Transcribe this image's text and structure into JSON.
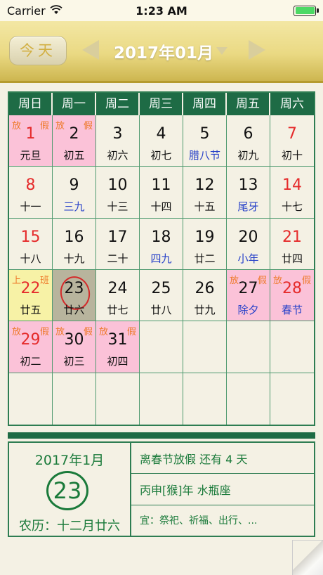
{
  "status": {
    "carrier": "Carrier",
    "time": "1:23 AM",
    "battery_color": "#4cd964"
  },
  "header": {
    "today_label": "今天",
    "month_title": "2017年01月"
  },
  "weekdays": [
    "周日",
    "周一",
    "周二",
    "周三",
    "周四",
    "周五",
    "周六"
  ],
  "days": [
    {
      "n": "1",
      "l": "元旦",
      "t1": "放",
      "t2": "假"
    },
    {
      "n": "2",
      "l": "初五",
      "t1": "放",
      "t2": "假"
    },
    {
      "n": "3",
      "l": "初六"
    },
    {
      "n": "4",
      "l": "初七"
    },
    {
      "n": "5",
      "l": "腊八节"
    },
    {
      "n": "6",
      "l": "初九"
    },
    {
      "n": "7",
      "l": "初十"
    },
    {
      "n": "8",
      "l": "十一"
    },
    {
      "n": "9",
      "l": "三九"
    },
    {
      "n": "10",
      "l": "十三"
    },
    {
      "n": "11",
      "l": "十四"
    },
    {
      "n": "12",
      "l": "十五"
    },
    {
      "n": "13",
      "l": "尾牙"
    },
    {
      "n": "14",
      "l": "十七"
    },
    {
      "n": "15",
      "l": "十八"
    },
    {
      "n": "16",
      "l": "十九"
    },
    {
      "n": "17",
      "l": "二十"
    },
    {
      "n": "18",
      "l": "四九"
    },
    {
      "n": "19",
      "l": "廿二"
    },
    {
      "n": "20",
      "l": "小年"
    },
    {
      "n": "21",
      "l": "廿四"
    },
    {
      "n": "22",
      "l": "廿五",
      "t1": "上",
      "t2": "班"
    },
    {
      "n": "23",
      "l": "廿六"
    },
    {
      "n": "24",
      "l": "廿七"
    },
    {
      "n": "25",
      "l": "廿八"
    },
    {
      "n": "26",
      "l": "廿九"
    },
    {
      "n": "27",
      "l": "除夕",
      "t1": "放",
      "t2": "假"
    },
    {
      "n": "28",
      "l": "春节",
      "t1": "放",
      "t2": "假"
    },
    {
      "n": "29",
      "l": "初二",
      "t1": "放",
      "t2": "假"
    },
    {
      "n": "30",
      "l": "初三",
      "t1": "放",
      "t2": "假"
    },
    {
      "n": "31",
      "l": "初四",
      "t1": "放",
      "t2": "假"
    }
  ],
  "info": {
    "year_month": "2017年1月",
    "day": "23",
    "lunar_date": "农历：十二月廿六",
    "countdown": "离春节放假 还有 4 天",
    "zodiac": "丙申[猴]年 水瓶座",
    "suitable": "宜：祭祀、祈福、出行、..."
  }
}
